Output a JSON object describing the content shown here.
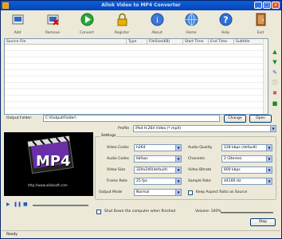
{
  "window": {
    "title": "Allok Video to MP4 Converter"
  },
  "toolbar": [
    {
      "label": "Add",
      "icon": "add-icon"
    },
    {
      "label": "Remove",
      "icon": "remove-icon"
    },
    {
      "label": "Convert",
      "icon": "convert-icon"
    },
    {
      "label": "Register",
      "icon": "register-icon"
    },
    {
      "label": "About",
      "icon": "about-icon"
    },
    {
      "label": "Home",
      "icon": "home-icon"
    },
    {
      "label": "Help",
      "icon": "help-icon"
    },
    {
      "label": "Exit",
      "icon": "exit-icon"
    }
  ],
  "grid": {
    "columns": [
      "Source File",
      "Type",
      "FileSize(KB)",
      "Start Time",
      "End Time",
      "Subtitle"
    ]
  },
  "output": {
    "label": "Output Folder:",
    "value": "C:\\Output\\Folder\\",
    "change_label": "Change",
    "open_label": "Open"
  },
  "profile": {
    "label": "Profile",
    "value": "iPod H.264 Video (*.mp4)"
  },
  "settings": {
    "legend": "Settings",
    "video_codec": {
      "label": "Video Codec",
      "value": "h264"
    },
    "audio_codec": {
      "label": "Audio Codec",
      "value": "libfaac"
    },
    "video_size": {
      "label": "Video Size",
      "value": "320x240(default)"
    },
    "frame_rate": {
      "label": "Frame Rate",
      "value": "25 fps"
    },
    "output_mode": {
      "label": "Output Mode",
      "value": "Normal"
    },
    "audio_quality": {
      "label": "Audio Quality",
      "value": "128 kbps (default)"
    },
    "audio_bitrate": {
      "label": "Channels",
      "value": "2 (Stereo)"
    },
    "sample_rate": {
      "label": "Sample Rate",
      "value": "44100 Hz"
    },
    "video_bitrate": {
      "label": "Video Bitrate",
      "value": "800 kbps"
    },
    "keep_aspect_label": "Keep Aspect Ratio as Source"
  },
  "preview": {
    "caption": "MP4",
    "url_text": "http://www.alloksoft.com"
  },
  "volume_label": "Volume: 100%",
  "shutdown_label": "Shut Down the computer when finished",
  "stop_label": "Stop",
  "status_text": "Ready"
}
